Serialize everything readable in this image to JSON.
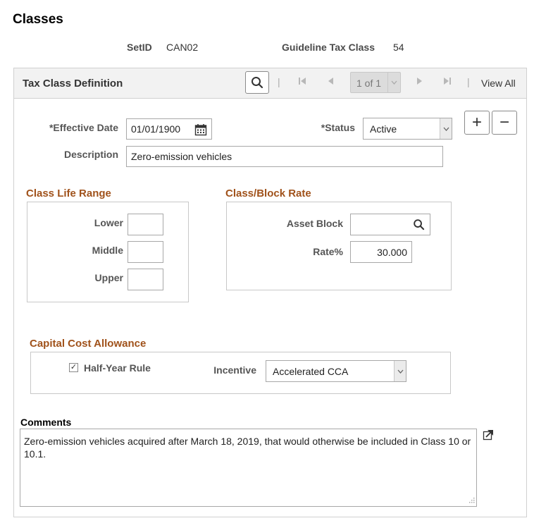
{
  "page": {
    "title": "Classes"
  },
  "header": {
    "setid_label": "SetID",
    "setid_value": "CAN02",
    "guideline_label": "Guideline Tax Class",
    "guideline_value": "54"
  },
  "panel": {
    "title": "Tax Class Definition",
    "pager_text": "1 of 1",
    "view_all": "View All",
    "separator": "|"
  },
  "form": {
    "effective_date_label": "*Effective Date",
    "effective_date_value": "01/01/1900",
    "status_label": "*Status",
    "status_value": "Active",
    "description_label": "Description",
    "description_value": "Zero-emission vehicles",
    "add_symbol": "+",
    "remove_symbol": "−"
  },
  "class_life_range": {
    "title": "Class Life Range",
    "lower_label": "Lower",
    "lower_value": "",
    "middle_label": "Middle",
    "middle_value": "",
    "upper_label": "Upper",
    "upper_value": ""
  },
  "class_block_rate": {
    "title": "Class/Block Rate",
    "asset_block_label": "Asset Block",
    "asset_block_value": "",
    "rate_label": "Rate%",
    "rate_value": "30.000"
  },
  "cca": {
    "title": "Capital Cost Allowance",
    "half_year_label": "Half-Year Rule",
    "half_year_checked": "✓",
    "incentive_label": "Incentive",
    "incentive_value": "Accelerated CCA"
  },
  "comments": {
    "label": "Comments",
    "text": "Zero-emission vehicles acquired after March 18, 2019, that would otherwise be included in Class 10 or 10.1."
  },
  "icons": {
    "search": "search-icon",
    "calendar": "calendar-icon",
    "first": "first-page-icon",
    "prev": "previous-icon",
    "next": "next-icon",
    "last": "last-page-icon",
    "expand": "expand-icon",
    "dropdown": "chevron-down-icon"
  },
  "colors": {
    "group_title": "#a0521b",
    "pager_bg": "#dcdcdc",
    "panel_header_bg": "#f2f2f2"
  }
}
